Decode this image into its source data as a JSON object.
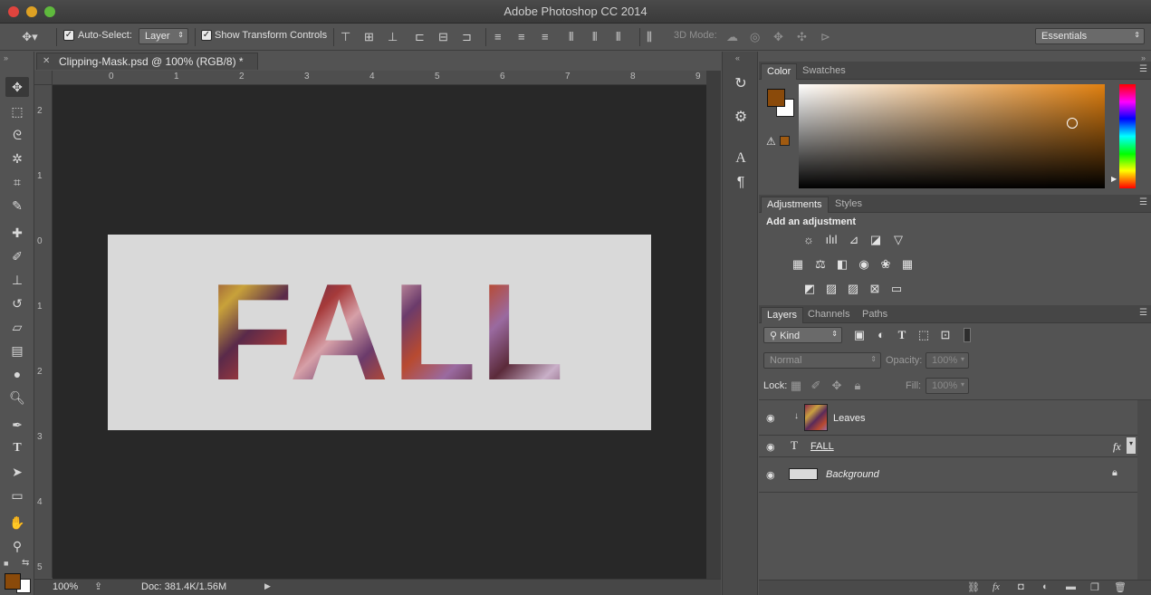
{
  "app": {
    "title": "Adobe Photoshop CC 2014"
  },
  "options": {
    "auto_select_label": "Auto-Select:",
    "auto_select_value": "Layer",
    "show_transform_label": "Show Transform Controls",
    "mode_3d_label": "3D Mode:",
    "workspace": "Essentials"
  },
  "document": {
    "tab_title": "Clipping-Mask.psd @ 100% (RGB/8) *",
    "canvas_text": "FALL",
    "ruler_top": [
      "0",
      "1",
      "2",
      "3",
      "4",
      "5",
      "6",
      "7",
      "8",
      "9"
    ],
    "ruler_left": [
      "2",
      "1",
      "0",
      "1",
      "2",
      "3",
      "4",
      "5"
    ]
  },
  "status": {
    "zoom": "100%",
    "doc_info": "Doc: 381.4K/1.56M"
  },
  "colors": {
    "foreground": "#8a4a0a",
    "background": "#ffffff",
    "accent_orange": "#e08010"
  },
  "panels": {
    "color_tab": "Color",
    "swatches_tab": "Swatches",
    "adjustments_tab": "Adjustments",
    "styles_tab": "Styles",
    "add_adjustment": "Add an adjustment",
    "layers_tab": "Layers",
    "channels_tab": "Channels",
    "paths_tab": "Paths"
  },
  "layers": {
    "filter_kind": "Kind",
    "blend_mode": "Normal",
    "opacity_label": "Opacity:",
    "opacity_value": "100%",
    "lock_label": "Lock:",
    "fill_label": "Fill:",
    "fill_value": "100%",
    "items": [
      {
        "name": "Leaves",
        "type": "image",
        "clipped": true
      },
      {
        "name": "FALL",
        "type": "text",
        "fx": "fx"
      },
      {
        "name": "Background",
        "type": "background",
        "locked": true
      }
    ]
  }
}
